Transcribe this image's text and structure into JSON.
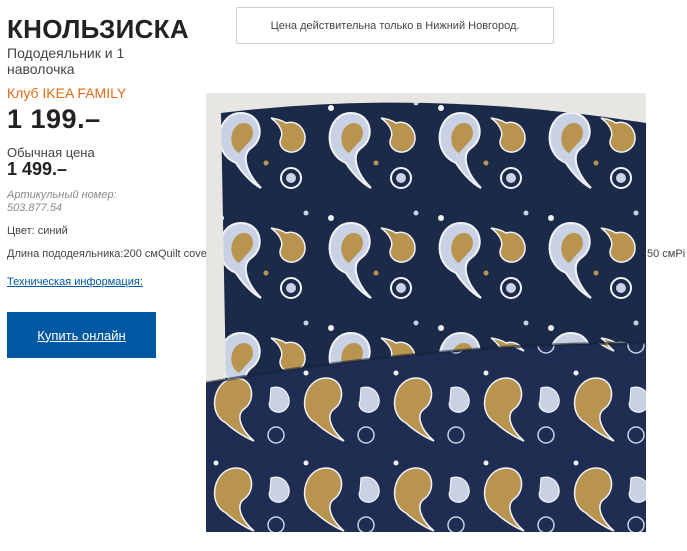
{
  "product": {
    "name": "КНОЛЬЗИСКА",
    "description": "Пододеяльник и 1 наволочка",
    "family_label": "Клуб IKEA FAMILY",
    "family_price": "1 199.–",
    "regular_label": "Обычная цена",
    "regular_price": "1 499.–",
    "article": "Артикульный номер: 503.877.54",
    "color": "Цвет: синий",
    "length_label": "Длина пододеяльника:200 смQuilt cover",
    "length_tail": "50 смPi",
    "tech_link": "Техническая информация:",
    "buy_label": "Купить онлайн"
  },
  "notice": {
    "text": "Цена действительна только в Нижний Новгород."
  },
  "image": {
    "alt_icon": "paisley-bedding-image",
    "colors": {
      "navy": "#1c2a4a",
      "gold": "#b8944f",
      "light": "#c9d2e4",
      "white": "#f1f3f7"
    }
  },
  "colors": {
    "accent": "#0058a3",
    "family": "#e26b17"
  }
}
